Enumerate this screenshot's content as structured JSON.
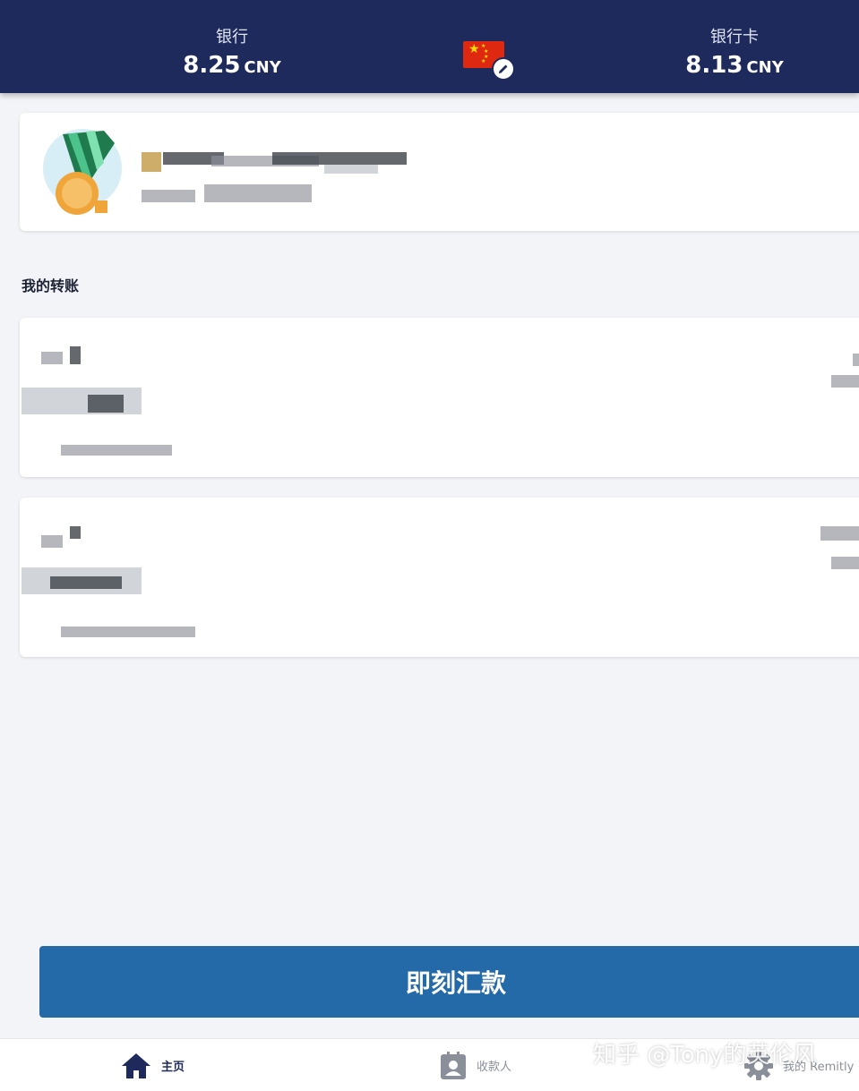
{
  "header": {
    "bank": {
      "label": "银行",
      "value": "8.25",
      "unit": "CNY"
    },
    "card": {
      "label": "银行卡",
      "value": "8.13",
      "unit": "CNY"
    },
    "country_flag": "china-flag",
    "edit_icon": "pencil-icon"
  },
  "promo": {
    "icon": "medal-icon"
  },
  "section": {
    "title": "我的转账"
  },
  "actions": {
    "send_now": "即刻汇款"
  },
  "nav": {
    "home": "主页",
    "recipients": "收款人",
    "account": "我的 Remitly"
  },
  "watermark": "知乎 @Tony的英伦风",
  "colors": {
    "header_bg": "#1f2a5c",
    "button_bg": "#256aa8",
    "page_bg": "#f2f4f8"
  }
}
